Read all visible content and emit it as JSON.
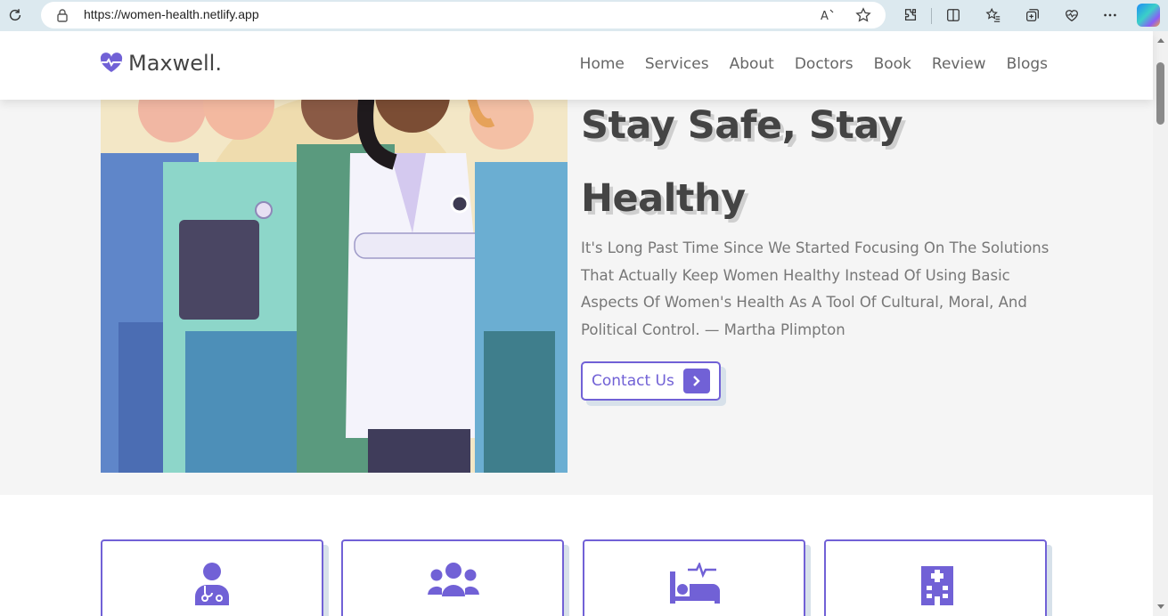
{
  "browser": {
    "url": "https://women-health.netlify.app",
    "icons": [
      "refresh-icon",
      "lock-icon",
      "read-aloud-icon",
      "favorite-star-icon",
      "extensions-icon",
      "split-screen-icon",
      "favorites-icon",
      "collections-icon",
      "browser-essentials-icon",
      "more-icon",
      "copilot-icon"
    ]
  },
  "header": {
    "logo_text": "Maxwell.",
    "nav": [
      "Home",
      "Services",
      "About",
      "Doctors",
      "Book",
      "Review",
      "Blogs"
    ]
  },
  "hero": {
    "title_line1": "Stay Safe, Stay",
    "title_line2": "Healthy",
    "text": "It's Long Past Time Since We Started Focusing On The Solutions That Actually Keep Women Healthy Instead Of Using Basic Aspects Of Women's Health As A Tool Of Cultural, Moral, And Political Control. — Martha Plimpton",
    "button_label": "Contact Us"
  },
  "cards": [
    {
      "icon": "doctor-icon"
    },
    {
      "icon": "users-icon"
    },
    {
      "icon": "hospital-bed-icon"
    },
    {
      "icon": "hospital-icon"
    }
  ],
  "colors": {
    "accent": "#7161d6",
    "text_dark": "#444444",
    "text_muted": "#777777",
    "hero_bg": "#f5f5f5",
    "browser_bg": "#dce9ef"
  }
}
